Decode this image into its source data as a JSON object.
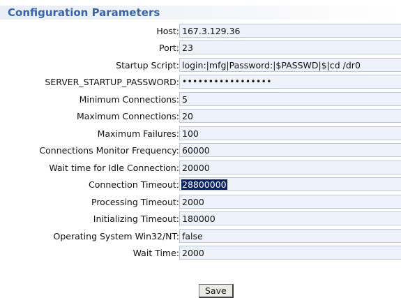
{
  "section": {
    "title": "Configuration Parameters"
  },
  "fields": [
    {
      "label": "Host:",
      "value": "167.3.129.36"
    },
    {
      "label": "Port:",
      "value": "23"
    },
    {
      "label": "Startup Script:",
      "value": "login:|mfg|Password:|$PASSWD|$|cd /dr0"
    },
    {
      "label": "SERVER_STARTUP_PASSWORD:",
      "value": "•••••••••••••••••"
    },
    {
      "label": "Minimum Connections:",
      "value": "5"
    },
    {
      "label": "Maximum Connections:",
      "value": "20"
    },
    {
      "label": "Maximum Failures:",
      "value": "100"
    },
    {
      "label": "Connections Monitor Frequency:",
      "value": "60000"
    },
    {
      "label": "Wait time for Idle Connection:",
      "value": "20000"
    },
    {
      "label": "Connection Timeout:",
      "value": "28800000"
    },
    {
      "label": "Processing Timeout:",
      "value": "2000"
    },
    {
      "label": "Initializing Timeout:",
      "value": "180000"
    },
    {
      "label": "Operating System Win32/NT:",
      "value": "false"
    },
    {
      "label": "Wait Time:",
      "value": "2000"
    }
  ],
  "actions": {
    "save_label": "Save"
  },
  "colors": {
    "header_text": "#3a64a8",
    "field_background": "#eef3fb",
    "field_border": "#b9c7d8",
    "selection": "#0a246a"
  }
}
